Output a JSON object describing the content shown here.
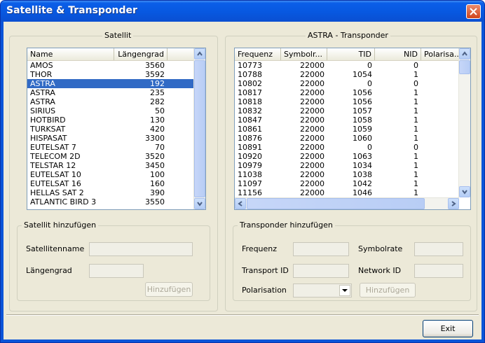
{
  "window": {
    "title": "Satellite & Transponder"
  },
  "satellite_panel": {
    "legend": "Satellit",
    "columns": [
      "Name",
      "Längengrad"
    ],
    "selected_index": 2,
    "rows": [
      [
        "AMOS",
        "3560"
      ],
      [
        "THOR",
        "3592"
      ],
      [
        "ASTRA",
        "192"
      ],
      [
        "ASTRA",
        "235"
      ],
      [
        "ASTRA",
        "282"
      ],
      [
        "SIRIUS",
        "50"
      ],
      [
        "HOTBIRD",
        "130"
      ],
      [
        "TURKSAT",
        "420"
      ],
      [
        "HISPASAT",
        "3300"
      ],
      [
        "EUTELSAT 7",
        "70"
      ],
      [
        "TELECOM 2D",
        "3520"
      ],
      [
        "TELSTAR 12",
        "3450"
      ],
      [
        "EUTELSAT 10",
        "100"
      ],
      [
        "EUTELSAT 16",
        "160"
      ],
      [
        "HELLAS SAT 2",
        "390"
      ],
      [
        "ATLANTIC BIRD 3",
        "3550"
      ]
    ]
  },
  "transponder_panel": {
    "legend": "ASTRA - Transponder",
    "columns": [
      "Frequenz",
      "Symbolr...",
      "TID",
      "NID",
      "Polarisa..."
    ],
    "rows": [
      [
        "10773",
        "22000",
        "0",
        "0"
      ],
      [
        "10788",
        "22000",
        "1054",
        "1"
      ],
      [
        "10802",
        "22000",
        "0",
        "0"
      ],
      [
        "10817",
        "22000",
        "1056",
        "1"
      ],
      [
        "10818",
        "22000",
        "1056",
        "1"
      ],
      [
        "10832",
        "22000",
        "1057",
        "1"
      ],
      [
        "10847",
        "22000",
        "1058",
        "1"
      ],
      [
        "10861",
        "22000",
        "1059",
        "1"
      ],
      [
        "10876",
        "22000",
        "1060",
        "1"
      ],
      [
        "10891",
        "22000",
        "0",
        "0"
      ],
      [
        "10920",
        "22000",
        "1063",
        "1"
      ],
      [
        "10979",
        "22000",
        "1034",
        "1"
      ],
      [
        "11038",
        "22000",
        "1038",
        "1"
      ],
      [
        "11097",
        "22000",
        "1042",
        "1"
      ],
      [
        "11156",
        "22000",
        "1046",
        "1"
      ]
    ]
  },
  "add_satellite": {
    "legend": "Satellit hinzufügen",
    "name_label": "Satellitenname",
    "name_value": "",
    "longitude_label": "Längengrad",
    "longitude_value": "",
    "add_button": "Hinzufügen"
  },
  "add_transponder": {
    "legend": "Transponder hinzufügen",
    "frequency_label": "Frequenz",
    "frequency_value": "",
    "symbolrate_label": "Symbolrate",
    "symbolrate_value": "",
    "transport_id_label": "Transport ID",
    "transport_id_value": "",
    "network_id_label": "Network ID",
    "network_id_value": "",
    "polarisation_label": "Polarisation",
    "polarisation_value": "",
    "add_button": "Hinzufügen"
  },
  "footer": {
    "exit_button": "Exit"
  },
  "colors": {
    "titlebar": "#0a5ee8",
    "selection": "#316ac5",
    "close": "#d0441c",
    "dialog_bg": "#ece9d8"
  }
}
